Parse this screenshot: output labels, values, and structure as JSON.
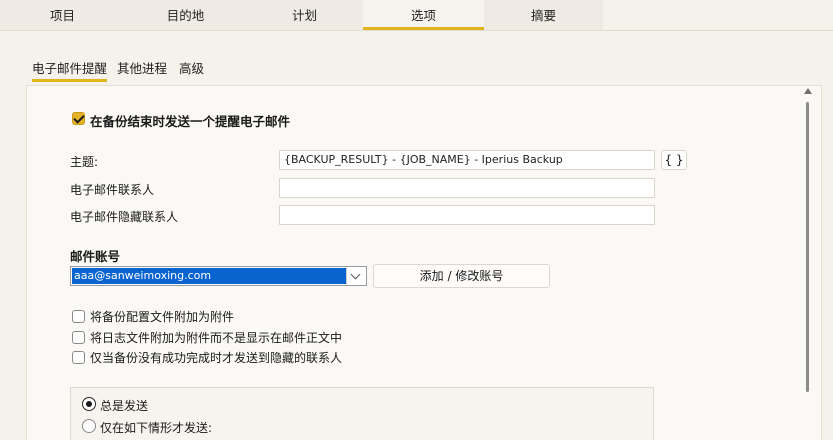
{
  "top_tabs": [
    {
      "label": "项目"
    },
    {
      "label": "目的地"
    },
    {
      "label": "计划"
    },
    {
      "label": "选项",
      "active": true
    },
    {
      "label": "摘要"
    }
  ],
  "sub_tabs": [
    {
      "label": "电子邮件提醒",
      "active": true
    },
    {
      "label": "其他进程"
    },
    {
      "label": "高级"
    }
  ],
  "email": {
    "send_checkbox_label": "在备份结束时发送一个提醒电子邮件",
    "send_checked": true,
    "subject_label": "主题:",
    "subject_value": "{BACKUP_RESULT} - {JOB_NAME} - Iperius Backup",
    "variables_button": "{ }",
    "contacts_label": "电子邮件联系人",
    "contacts_value": "",
    "hidden_contacts_label": "电子邮件隐藏联系人",
    "hidden_contacts_value": ""
  },
  "account": {
    "section_label": "邮件账号",
    "selected_account": "aaa@sanweimoxing.com",
    "add_edit_button": "添加 / 修改账号"
  },
  "options": [
    {
      "label": "将备份配置文件附加为附件",
      "checked": false
    },
    {
      "label": "将日志文件附加为附件而不是显示在邮件正文中",
      "checked": false
    },
    {
      "label": "仅当备份没有成功完成时才发送到隐藏的联系人",
      "checked": false
    }
  ],
  "send_mode": {
    "always_label": "总是发送",
    "conditional_label": "仅在如下情形才发送:",
    "selected": "always"
  },
  "colors": {
    "accent": "#e3b31c",
    "selection": "#0a64d0"
  }
}
